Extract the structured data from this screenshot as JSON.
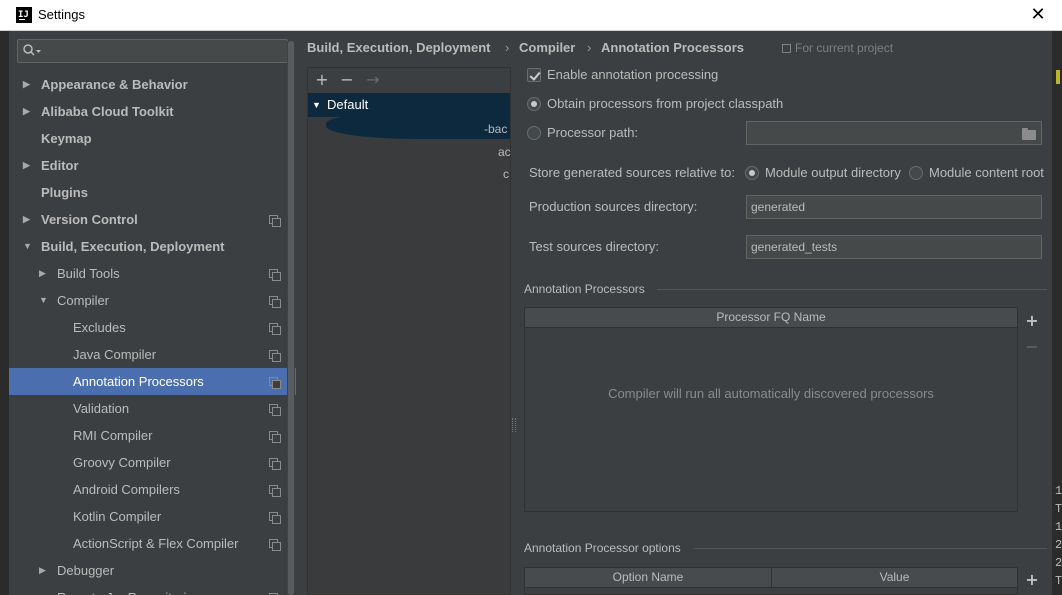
{
  "window": {
    "title": "Settings",
    "close_glyph": "✕",
    "app_icon": "IJ"
  },
  "search": {
    "placeholder": "",
    "icon": "search-icon"
  },
  "tree": [
    {
      "label": "Appearance & Behavior",
      "level": 0,
      "bold": true,
      "arrow": "right",
      "proj": false,
      "selected": false
    },
    {
      "label": "Alibaba Cloud Toolkit",
      "level": 0,
      "bold": true,
      "arrow": "right",
      "proj": false,
      "selected": false
    },
    {
      "label": "Keymap",
      "level": 0,
      "bold": true,
      "arrow": "",
      "proj": false,
      "selected": false
    },
    {
      "label": "Editor",
      "level": 0,
      "bold": true,
      "arrow": "right",
      "proj": false,
      "selected": false
    },
    {
      "label": "Plugins",
      "level": 0,
      "bold": true,
      "arrow": "",
      "proj": false,
      "selected": false
    },
    {
      "label": "Version Control",
      "level": 0,
      "bold": true,
      "arrow": "right",
      "proj": true,
      "selected": false
    },
    {
      "label": "Build, Execution, Deployment",
      "level": 0,
      "bold": true,
      "arrow": "down",
      "proj": false,
      "selected": false
    },
    {
      "label": "Build Tools",
      "level": 1,
      "bold": false,
      "arrow": "right",
      "proj": true,
      "selected": false
    },
    {
      "label": "Compiler",
      "level": 1,
      "bold": false,
      "arrow": "down",
      "proj": true,
      "selected": false
    },
    {
      "label": "Excludes",
      "level": 2,
      "bold": false,
      "arrow": "",
      "proj": true,
      "selected": false
    },
    {
      "label": "Java Compiler",
      "level": 2,
      "bold": false,
      "arrow": "",
      "proj": true,
      "selected": false
    },
    {
      "label": "Annotation Processors",
      "level": 2,
      "bold": false,
      "arrow": "",
      "proj": true,
      "selected": true
    },
    {
      "label": "Validation",
      "level": 2,
      "bold": false,
      "arrow": "",
      "proj": true,
      "selected": false
    },
    {
      "label": "RMI Compiler",
      "level": 2,
      "bold": false,
      "arrow": "",
      "proj": true,
      "selected": false
    },
    {
      "label": "Groovy Compiler",
      "level": 2,
      "bold": false,
      "arrow": "",
      "proj": true,
      "selected": false
    },
    {
      "label": "Android Compilers",
      "level": 2,
      "bold": false,
      "arrow": "",
      "proj": true,
      "selected": false
    },
    {
      "label": "Kotlin Compiler",
      "level": 2,
      "bold": false,
      "arrow": "",
      "proj": true,
      "selected": false
    },
    {
      "label": "ActionScript & Flex Compiler",
      "level": 2,
      "bold": false,
      "arrow": "",
      "proj": true,
      "selected": false
    },
    {
      "label": "Debugger",
      "level": 1,
      "bold": false,
      "arrow": "right",
      "proj": false,
      "selected": false
    },
    {
      "label": "Remote Jar Repositories",
      "level": 1,
      "bold": false,
      "arrow": "",
      "proj": true,
      "selected": false
    }
  ],
  "breadcrumb": {
    "items": [
      "Build, Execution, Deployment",
      "Compiler",
      "Annotation Processors"
    ],
    "separator": "›",
    "scope": "For current project"
  },
  "profiles": {
    "toolbar": {
      "add": "+",
      "remove": "−",
      "move": "→"
    },
    "default_label": "Default",
    "clipped_texts": [
      "-bac",
      "ac",
      "c"
    ]
  },
  "settings": {
    "enable_label": "Enable annotation processing",
    "enable_checked": true,
    "obtain_label": "Obtain processors from project classpath",
    "path_label": "Processor path:",
    "path_value": "",
    "store_label": "Store generated sources relative to:",
    "store_opt1": "Module output directory",
    "store_opt2": "Module content root",
    "prod_label": "Production sources directory:",
    "prod_value": "generated",
    "test_label": "Test sources directory:",
    "test_value": "generated_tests"
  },
  "processors": {
    "section": "Annotation Processors",
    "column": "Processor FQ Name",
    "empty": "Compiler will run all automatically discovered processors",
    "add": "+",
    "remove": "−"
  },
  "options": {
    "section": "Annotation Processor options",
    "col_name": "Option Name",
    "col_value": "Value",
    "add": "+"
  },
  "edge_chars": [
    "1",
    "T",
    "1",
    "2",
    "2",
    "T"
  ],
  "colors": {
    "selection": "#4b6eaf",
    "background": "#3c3f41",
    "profile_selected": "#0d293e"
  }
}
